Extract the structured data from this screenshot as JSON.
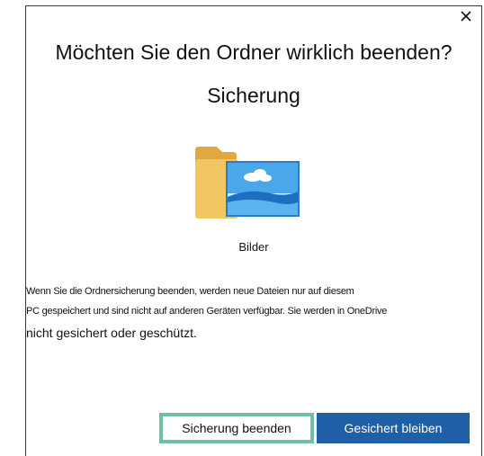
{
  "dialog": {
    "title": "Möchten Sie den Ordner wirklich beenden?",
    "subtitle": "Sicherung",
    "close_icon": "close-icon",
    "folder": {
      "icon": "pictures-folder-icon",
      "label": "Bilder"
    },
    "description": {
      "line1": "Wenn Sie die Ordnersicherung beenden, werden neue Dateien nur auf diesem",
      "line2": "PC gespeichert und sind nicht auf anderen Geräten verfügbar. Sie werden in OneDrive",
      "line3": "nicht gesichert oder geschützt."
    },
    "buttons": {
      "stop_label": "Sicherung beenden",
      "keep_label": "Gesichert bleiben"
    },
    "colors": {
      "primary": "#1e5fa6",
      "focus_highlight": "#6fbfa6",
      "folder_yellow": "#f2c661",
      "image_blue": "#3b9be0"
    }
  }
}
